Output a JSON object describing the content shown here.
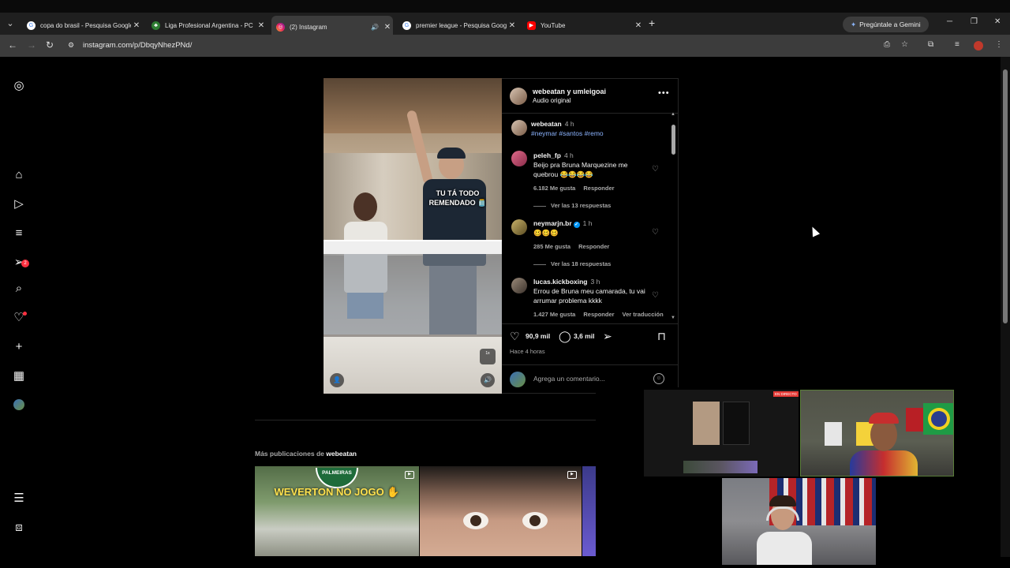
{
  "browser": {
    "tabs": [
      {
        "title": "copa do brasil - Pesquisa Google",
        "favicon": "google-icon",
        "active": false
      },
      {
        "title": "Liga Profesional Argentina - PC",
        "favicon": "leaf-icon",
        "active": false
      },
      {
        "title": "(2) Instagram",
        "favicon": "instagram-icon",
        "active": true
      },
      {
        "title": "premier league - Pesquisa Google",
        "favicon": "google-icon",
        "active": false
      },
      {
        "title": "YouTube",
        "favicon": "youtube-icon",
        "active": false
      }
    ],
    "gemini_label": "Pregúntale a Gemini",
    "url": "instagram.com/p/DbqyNhezPNd/"
  },
  "sidebar": {
    "notification_count": "2"
  },
  "post": {
    "video_caption": "TU TÁ TODO REMENDADO 🫙",
    "speed_label": "1x",
    "header_title": "webeatan y umleigoai",
    "header_sub": "Audio original",
    "comments": [
      {
        "user": "peleh_fp",
        "time": "4 h",
        "text": "Beijo pra Bruna Marquezine me quebrou 😂😂😂😂",
        "likes": "6.182 Me gusta",
        "reply_label": "Responder",
        "view_replies": "Ver las 13 respuestas"
      },
      {
        "user": "neymarjn.br",
        "time": "1 h",
        "text": "🥴🥴🥴",
        "likes": "285 Me gusta",
        "reply_label": "Responder",
        "view_replies": "Ver las 18 respuestas"
      },
      {
        "user": "lucas.kickboxing",
        "time": "3 h",
        "text": "Errou de Bruna meu camarada, tu vai arrumar problema kkkk",
        "likes": "1.427 Me gusta",
        "reply_label": "Responder",
        "translate_label": "Ver traducción"
      }
    ],
    "caption": {
      "user": "webeatan",
      "time": "4 h",
      "tags": "#neymar #santos #remo"
    },
    "like_count": "90,9 mil",
    "comment_count": "3,6 mil",
    "posted_ago": "Hace 4 horas",
    "comment_placeholder": "Agrega un comentario..."
  },
  "more_posts": {
    "prefix": "Más publicaciones de",
    "user": "webeatan",
    "thumb1_badge": "PALMEIRAS",
    "thumb1_text": "WEVERTON NO JOGO ✋"
  },
  "stream": {
    "live_label": "EN DIRECTO"
  }
}
